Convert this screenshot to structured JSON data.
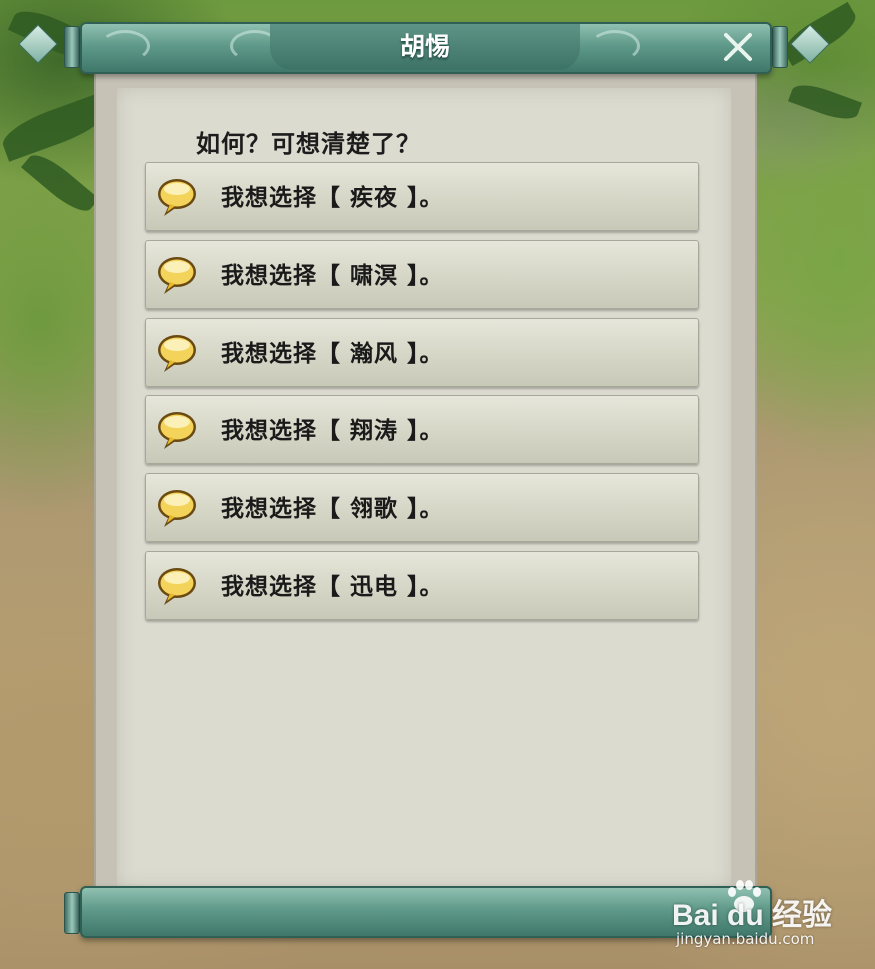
{
  "dialog": {
    "title": "胡惕",
    "prompt": "如何？可想清楚了？",
    "close_icon": "close-x-icon",
    "options": [
      {
        "label": "我想选择【 疾夜 】。",
        "icon": "speech-bubble-icon"
      },
      {
        "label": "我想选择【 啸溟 】。",
        "icon": "speech-bubble-icon"
      },
      {
        "label": "我想选择【 瀚风 】。",
        "icon": "speech-bubble-icon"
      },
      {
        "label": "我想选择【 翔涛 】。",
        "icon": "speech-bubble-icon"
      },
      {
        "label": "我想选择【 翎歌 】。",
        "icon": "speech-bubble-icon"
      },
      {
        "label": "我想选择【 迅电 】。",
        "icon": "speech-bubble-icon"
      }
    ]
  },
  "watermark": {
    "brand": "Bai du 经验",
    "site": "jingyan.baidu.com"
  },
  "colors": {
    "scroll_teal": "#5f9989",
    "paper": "#dcdbd0",
    "bubble_gold": "#e8b92a"
  }
}
